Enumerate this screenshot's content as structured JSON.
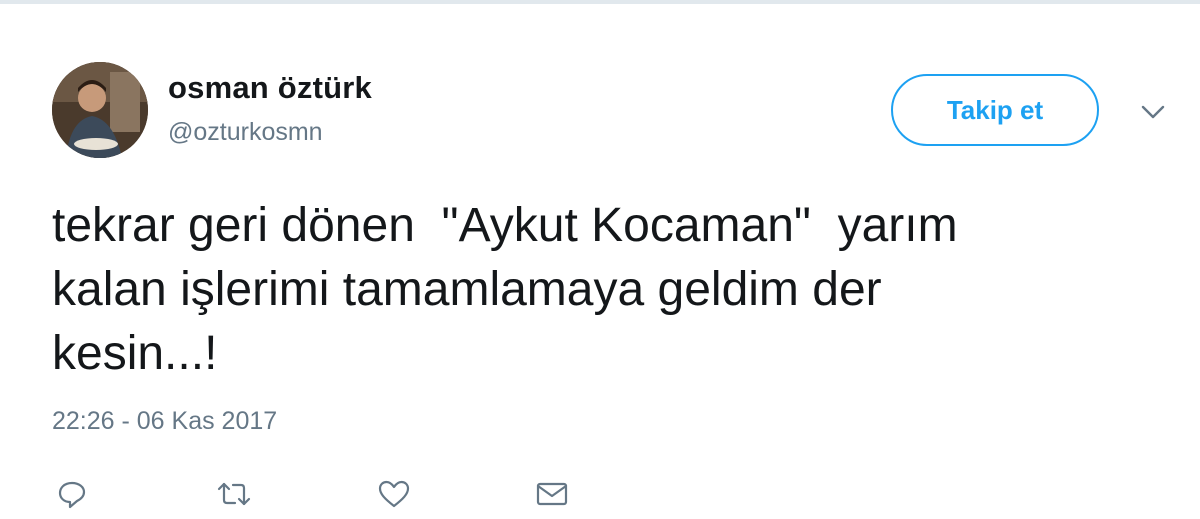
{
  "user": {
    "name": "osman öztürk",
    "handle": "@ozturkosmn"
  },
  "follow_button": {
    "label": "Takip et"
  },
  "tweet": {
    "text": "tekrar geri dönen  \"Aykut Kocaman\"  yarım\nkalan işlerimi tamamlamaya geldim der\nkesin...!",
    "timestamp": "22:26 - 06 Kas 2017"
  },
  "actions": [
    {
      "icon": "reply-icon"
    },
    {
      "icon": "retweet-icon"
    },
    {
      "icon": "like-icon"
    },
    {
      "icon": "direct-message-icon"
    }
  ],
  "colors": {
    "accent": "#1da1f2",
    "text": "#14171a",
    "secondary": "#657786"
  }
}
